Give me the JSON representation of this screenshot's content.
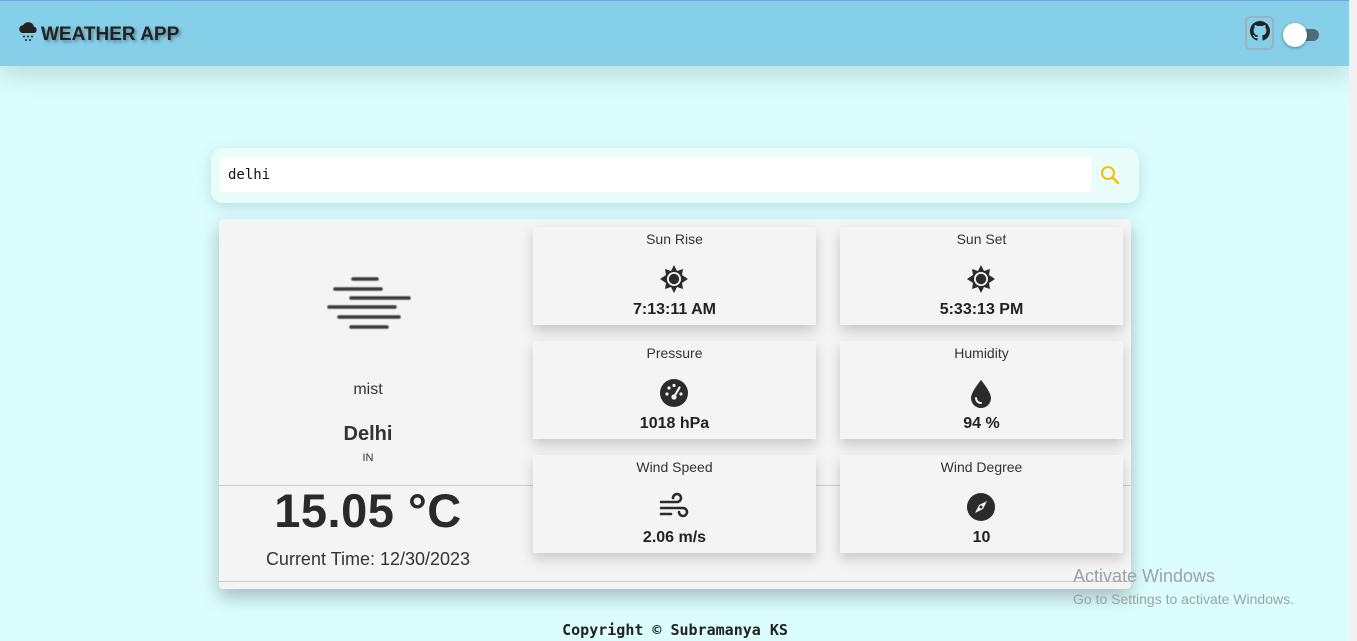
{
  "header": {
    "title": "WEATHER APP",
    "logo_icon": "cloud-rain-icon",
    "github_icon": "github-icon"
  },
  "search": {
    "value": "delhi",
    "search_icon": "search-icon"
  },
  "weather": {
    "description": "mist",
    "city": "Delhi",
    "country": "IN",
    "temperature": "15.05 °C",
    "current_time": "Current Time: 12/30/2023",
    "condition_icon": "mist-icon"
  },
  "tiles": [
    {
      "label": "Sun Rise",
      "value": "7:13:11 AM",
      "icon": "sun-icon"
    },
    {
      "label": "Sun Set",
      "value": "5:33:13 PM",
      "icon": "sun-icon"
    },
    {
      "label": "Pressure",
      "value": "1018 hPa",
      "icon": "gauge-icon"
    },
    {
      "label": "Humidity",
      "value": "94 %",
      "icon": "droplet-icon"
    },
    {
      "label": "Wind Speed",
      "value": "2.06 m/s",
      "icon": "wind-icon"
    },
    {
      "label": "Wind Degree",
      "value": "10",
      "icon": "compass-icon"
    }
  ],
  "watermark": {
    "line1": "Activate Windows",
    "line2": "Go to Settings to activate Windows."
  },
  "footer": {
    "copyright": "Copyright © Subramanya KS"
  },
  "colors": {
    "header_bg": "#86cfe8",
    "page_bg": "#dbfdfd",
    "card_bg": "#f4f4f4",
    "search_icon": "#f2c200"
  }
}
